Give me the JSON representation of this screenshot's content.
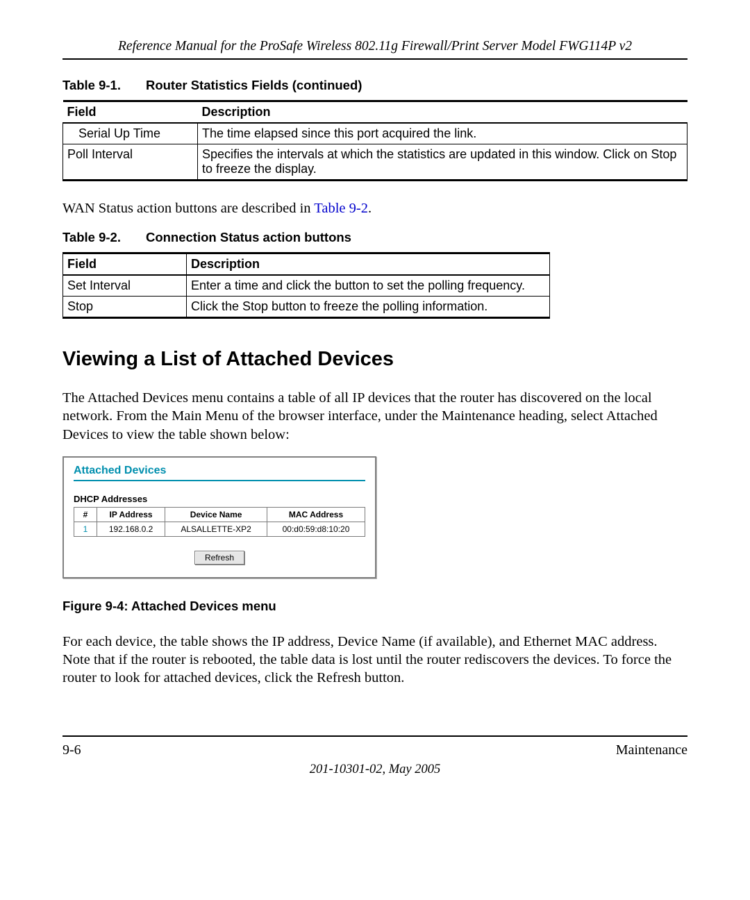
{
  "header": {
    "running_head": "Reference Manual for the ProSafe Wireless 802.11g  Firewall/Print Server Model FWG114P v2"
  },
  "table91": {
    "caption_label": "Table 9-1.",
    "caption_title": "Router Statistics Fields (continued)",
    "col_field": "Field",
    "col_desc": "Description",
    "rows": [
      {
        "field": "Serial Up Time",
        "indent": true,
        "desc": "The time elapsed since this port acquired the link."
      },
      {
        "field": "Poll Interval",
        "indent": false,
        "desc": "Specifies the intervals at which the statistics are updated in this window. Click on Stop to freeze the display."
      }
    ]
  },
  "para_wan": {
    "pre": "WAN Status action buttons are described in ",
    "link": "Table 9-2",
    "post": "."
  },
  "table92": {
    "caption_label": "Table 9-2.",
    "caption_title": "Connection Status action buttons",
    "col_field": "Field",
    "col_desc": "Description",
    "rows": [
      {
        "field": "Set Interval",
        "desc": "Enter a time and click the button to set the polling frequency."
      },
      {
        "field": "Stop",
        "desc": "Click the Stop button to freeze the polling information."
      }
    ]
  },
  "section_heading": "Viewing a List of Attached Devices",
  "para_adev_intro": "The Attached Devices menu contains a table of all IP devices that the router has discovered on the local network. From the Main Menu of the browser interface, under the Maintenance heading, select Attached Devices to view the table shown below:",
  "attached_devices": {
    "title": "Attached Devices",
    "subtitle": "DHCP Addresses",
    "cols": {
      "num": "#",
      "ip": "IP Address",
      "name": "Device Name",
      "mac": "MAC Address"
    },
    "rows": [
      {
        "num": "1",
        "ip": "192.168.0.2",
        "name": "ALSALLETTE-XP2",
        "mac": "00:d0:59:d8:10:20"
      }
    ],
    "refresh_label": "Refresh"
  },
  "figure_caption": "Figure 9-4:  Attached Devices menu",
  "para_adev_post": "For each device, the table shows the IP address, Device Name (if available), and Ethernet MAC address. Note that if the router is rebooted, the table data is lost until the router rediscovers the devices. To force the router to look for attached devices, click the Refresh button.",
  "footer": {
    "page": "9-6",
    "chapter": "Maintenance",
    "docnum": "201-10301-02, May 2005"
  }
}
